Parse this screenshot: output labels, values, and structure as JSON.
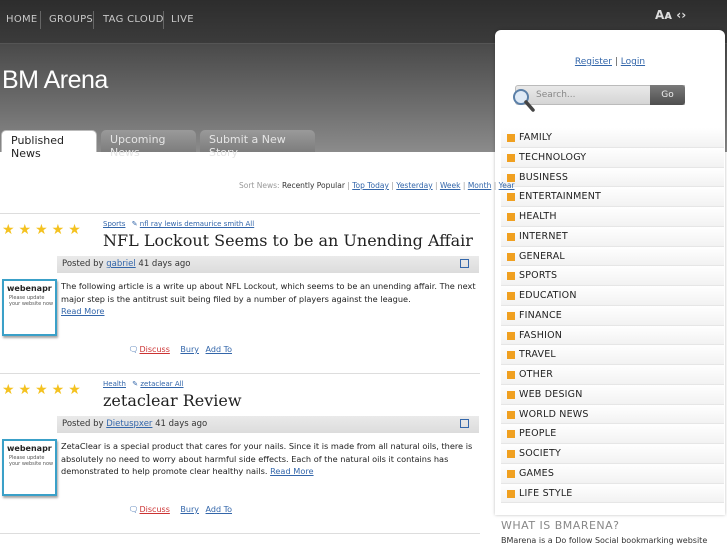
{
  "topnav": {
    "items": [
      "HOME",
      "GROUPS",
      "TAG CLOUD",
      "LIVE"
    ],
    "font_toggle": "Aᴀ ‹›"
  },
  "site": {
    "title": "BM Arena"
  },
  "tabs": [
    "Published News",
    "Upcoming News",
    "Submit a New Story"
  ],
  "sidebar": {
    "register": "Register",
    "auth_sep": "|",
    "login": "Login",
    "search_placeholder": "Search...",
    "go": "Go",
    "categories": [
      "FAMILY",
      "TECHNOLOGY",
      "BUSINESS",
      "ENTERTAINMENT",
      "HEALTH",
      "INTERNET",
      "GENERAL",
      "SPORTS",
      "EDUCATION",
      "FINANCE",
      "FASHION",
      "TRAVEL",
      "OTHER",
      "WEB DESIGN",
      "WORLD NEWS",
      "PEOPLE",
      "SOCIETY",
      "GAMES",
      "LIFE STYLE"
    ],
    "what_title": "WHAT IS BMARENA?",
    "what_text": "BMarena is a Do follow Social bookmarking website"
  },
  "sort": {
    "label": "Sort News:",
    "current": "Recently Popular",
    "options": [
      "Top Today",
      "Yesterday",
      "Week",
      "Month",
      "Year"
    ]
  },
  "stories": [
    {
      "category": "Sports",
      "tags": "nfl ray lewis demaurice smith All",
      "title": "NFL Lockout Seems to be an Unending Affair",
      "posted_by_label": "Posted by",
      "author": "gabriel",
      "age": "41 days ago",
      "body": "The following article is a write up about NFL Lockout, which seems to be an unending affair. The next major step is the antitrust suit being filed by a number of players against the league.",
      "read_more": "Read More",
      "discuss": "Discuss",
      "bury": "Bury",
      "add_to": "Add To",
      "thumb_title": "webenapr",
      "thumb_sub": "Please update your website now"
    },
    {
      "category": "Health",
      "tags": "zetaclear All",
      "title": "zetaclear Review",
      "posted_by_label": "Posted by",
      "author": "Dietuspxer",
      "age": "41 days ago",
      "body": "ZetaClear is a special product that cares for your nails. Since it is made from all natural oils, there is absolutely no need to worry about harmful side effects. Each of the natural oils it contains has demonstrated to help promote clear healthy nails.",
      "read_more": "Read More",
      "discuss": "Discuss",
      "bury": "Bury",
      "add_to": "Add To",
      "thumb_title": "webenapr",
      "thumb_sub": "Please update your website now"
    }
  ]
}
